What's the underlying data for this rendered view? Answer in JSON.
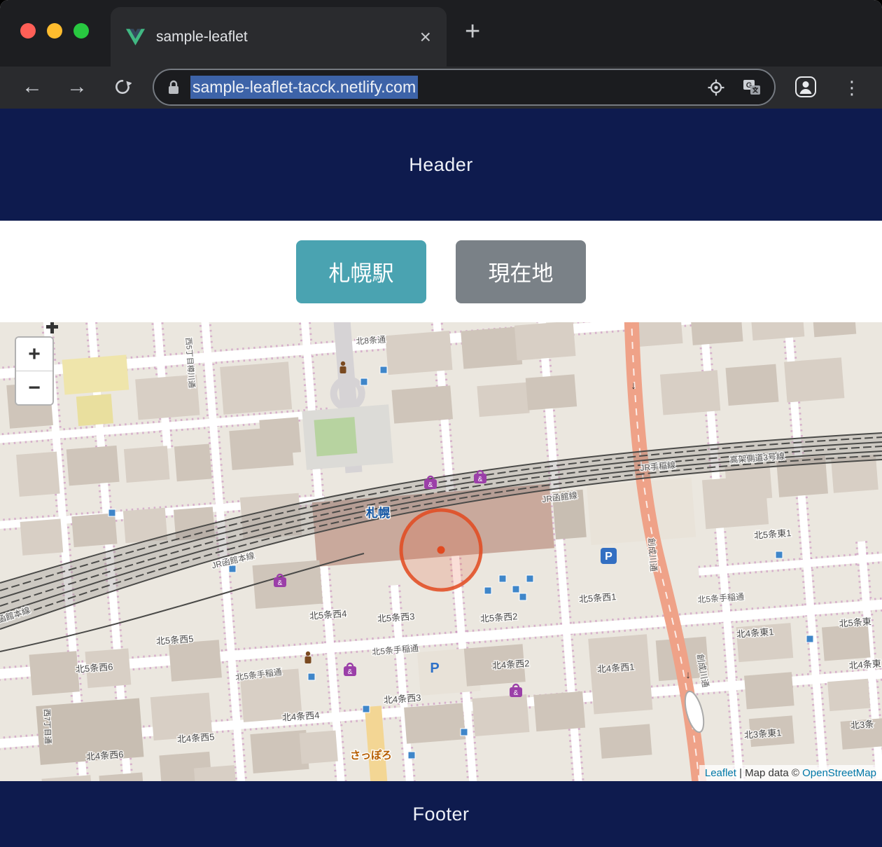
{
  "browser": {
    "tab_title": "sample-leaflet",
    "close_tab_label": "×",
    "new_tab_label": "+",
    "url": "sample-leaflet-tacck.netlify.com",
    "icons": {
      "back": "←",
      "forward": "→",
      "reload": "reload-icon",
      "menu": "⋮",
      "favicon": "vue-logo-icon",
      "lock": "lock-icon",
      "geolocation": "geolocation-icon",
      "translate": "translate-icon",
      "profile": "profile-icon"
    }
  },
  "page": {
    "header_title": "Header",
    "footer_title": "Footer",
    "station_button": "札幌駅",
    "location_button": "現在地"
  },
  "map": {
    "zoom_in_label": "+",
    "zoom_out_label": "−",
    "attribution": {
      "leaflet_link": "Leaflet",
      "text": " | Map data © ",
      "osm_link": "OpenStreetMap"
    },
    "colors": {
      "marker": "#e2491f",
      "road_orange": "#efa288",
      "navy": "#0e1b4e",
      "button_teal": "#4aa3b1",
      "button_gray": "#7a8187"
    },
    "labels": [
      "北8条通",
      "西5丁目樽川通",
      "高架側道3号線",
      "JR手稲線",
      "JR函館線",
      "札幌",
      "JR函館本線",
      "JR函館本線",
      "創成川通",
      "創成川通",
      "北5条東1",
      "北5条手稲通",
      "北5条西1",
      "北5条西2",
      "北5条西3",
      "北5条西4",
      "北5条西5",
      "北5条西6",
      "北5条手稲通",
      "北5条手稲通",
      "北4条東1",
      "北4条西1",
      "北4条西2",
      "北4条西3",
      "北4条西4",
      "北4条西5",
      "北4条西6",
      "北3条東1",
      "さっぽろ",
      "西7丁目通",
      "北5条東",
      "北3条",
      "P",
      "北4条東"
    ]
  }
}
